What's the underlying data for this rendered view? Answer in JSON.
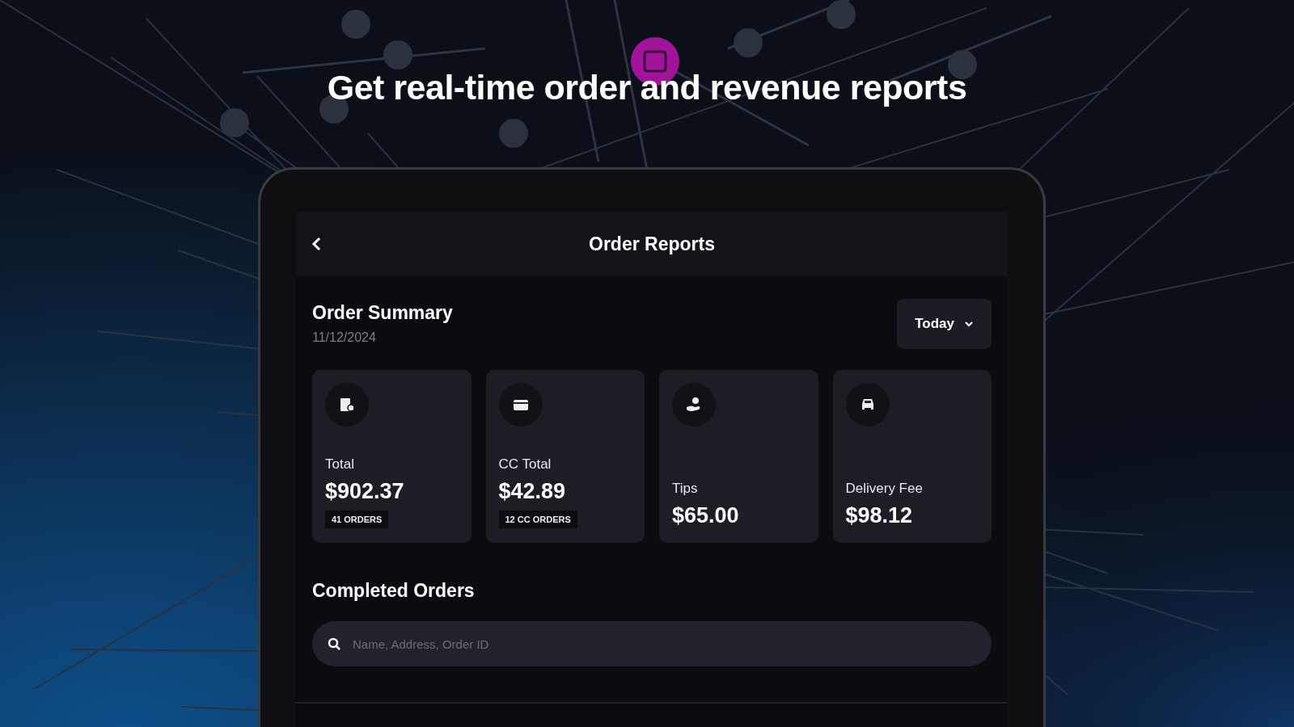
{
  "headline": "Get real-time order and revenue reports",
  "header": {
    "title": "Order Reports"
  },
  "summary": {
    "title": "Order Summary",
    "date": "11/12/2024",
    "period": "Today"
  },
  "cards": [
    {
      "label": "Total",
      "value": "$902.37",
      "badge": "41 ORDERS"
    },
    {
      "label": "CC Total",
      "value": "$42.89",
      "badge": "12 CC ORDERS"
    },
    {
      "label": "Tips",
      "value": "$65.00"
    },
    {
      "label": "Delivery Fee",
      "value": "$98.12"
    }
  ],
  "completed": {
    "title": "Completed Orders",
    "search_placeholder": "Name, Address, Order ID"
  }
}
